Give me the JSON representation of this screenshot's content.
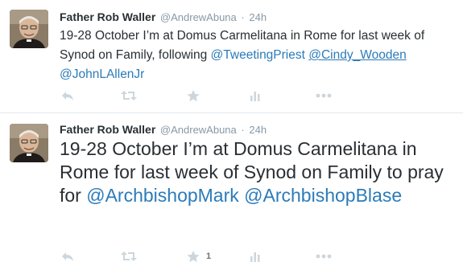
{
  "tweets": [
    {
      "name": "Father Rob Waller",
      "handle": "@AndrewAbuna",
      "separator": "·",
      "time": "24h",
      "text_part1": "19-28 October I’m at Domus Carmelitana in Rome for last week of Synod on Family, following ",
      "mention1": "@TweetingPriest",
      "mention2": "@Cindy_Wooden",
      "mention3": "@JohnLAllenJr",
      "favorite_count": ""
    },
    {
      "name": "Father Rob Waller",
      "handle": "@AndrewAbuna",
      "separator": "·",
      "time": "24h",
      "text_part1": "19-28 October I’m at Domus Carmelitana in Rome for last week of Synod on Family to pray for ",
      "mention1": "@ArchbishopMark",
      "mention2": "@ArchbishopBlase",
      "favorite_count": "1"
    }
  ],
  "icons": {
    "reply": "reply-icon",
    "retweet": "retweet-icon",
    "favorite": "star-icon",
    "stats": "bar-chart-icon",
    "more": "more-dots-icon"
  },
  "colors": {
    "link": "#2b7bb9",
    "text": "#292f33",
    "muted": "#8899a6",
    "action_icon": "#ccd6dd",
    "divider": "#e1e8ed"
  }
}
